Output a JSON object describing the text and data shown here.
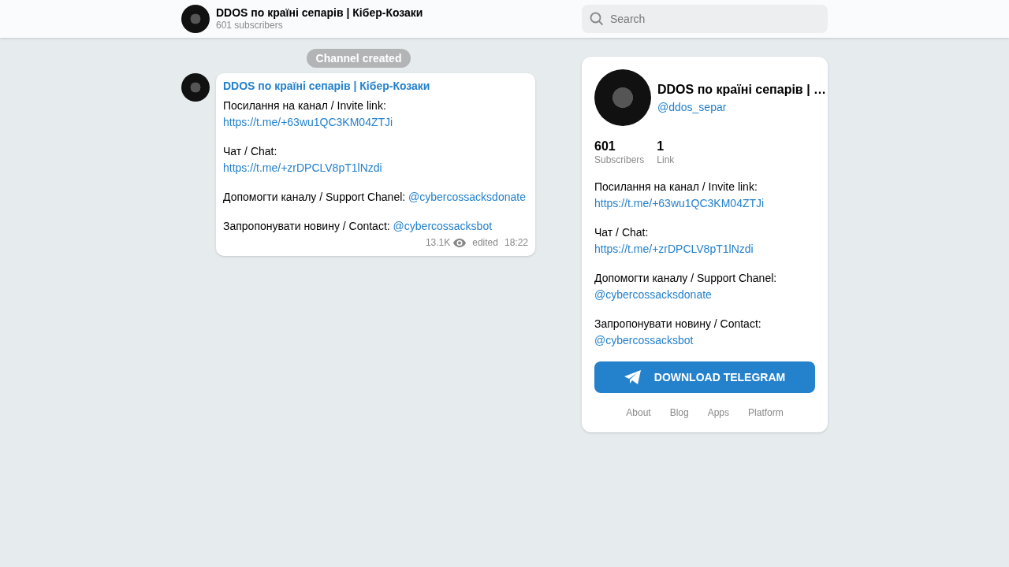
{
  "header": {
    "title": "DDOS по країні сепарів | Кібер-Козаки",
    "subtitle": "601 subscribers",
    "search": {
      "placeholder": "Search"
    }
  },
  "service_message": "Channel created",
  "message": {
    "author": "DDOS по країні сепарів | Кібер-Козаки",
    "paragraphs": [
      [
        [
          {
            "kind": "text",
            "text": "Посилання на канал / Invite link:"
          },
          {
            "kind": "link",
            "text": "https://t.me/+63wu1QC3KM04ZTJi"
          }
        ]
      ],
      [
        [
          {
            "kind": "text",
            "text": "Чат / Chat:"
          }
        ],
        [
          {
            "kind": "link",
            "text": "https://t.me/+zrDPCLV8pT1lNzdi"
          }
        ]
      ],
      [
        [
          {
            "kind": "text",
            "text": "Допомогти каналу / Support Chanel:"
          },
          {
            "kind": "link",
            "text": "@cybercossacksdonate"
          }
        ]
      ],
      [
        [
          {
            "kind": "text",
            "text": "Запропонувати новину / Contact:"
          },
          {
            "kind": "link",
            "text": "@cybercossacksbot"
          }
        ]
      ]
    ],
    "views": "13.1K",
    "edited": "edited",
    "time": "18:22"
  },
  "channel_card": {
    "name": "DDOS по країні сепарів | …",
    "username": "@ddos_separ",
    "stats": [
      {
        "value": "601",
        "label": "Subscribers"
      },
      {
        "value": "1",
        "label": "Link"
      }
    ],
    "paragraphs": [
      [
        [
          {
            "kind": "text",
            "text": "Посилання на канал / Invite link:"
          },
          {
            "kind": "link",
            "text": "https://t.me/+63wu1QC3KM04ZTJi"
          }
        ]
      ],
      [
        [
          {
            "kind": "text",
            "text": "Чат / Chat:"
          }
        ],
        [
          {
            "kind": "link",
            "text": "https://t.me/+zrDPCLV8pT1lNzdi"
          }
        ]
      ],
      [
        [
          {
            "kind": "text",
            "text": "Допомогти каналу / Support Chanel:"
          },
          {
            "kind": "link",
            "text": "@cybercossacksdonate"
          }
        ]
      ],
      [
        [
          {
            "kind": "text",
            "text": "Запропонувати новину / Contact:"
          },
          {
            "kind": "link",
            "text": "@cybercossacksbot"
          }
        ]
      ]
    ],
    "button": "DOWNLOAD TELEGRAM",
    "footer_links": [
      "About",
      "Blog",
      "Apps",
      "Platform"
    ]
  }
}
